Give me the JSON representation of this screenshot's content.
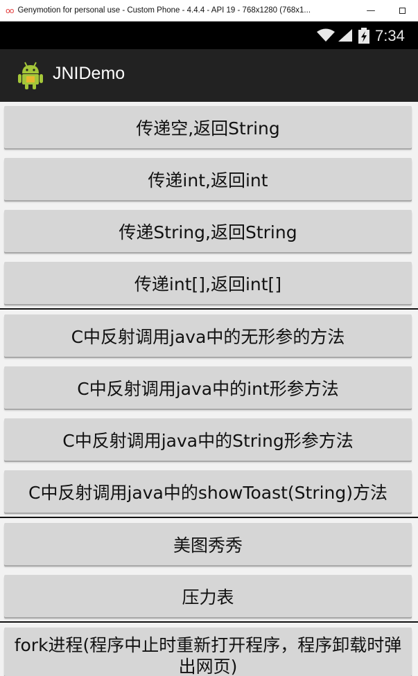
{
  "window": {
    "title": "Genymotion for personal use - Custom Phone - 4.4.4 - API 19 - 768x1280 (768x1...",
    "minimize_glyph": "—"
  },
  "status_bar": {
    "time": "7:34"
  },
  "action_bar": {
    "app_title": "JNIDemo"
  },
  "buttons": [
    {
      "label": "传递空,返回String"
    },
    {
      "label": "传递int,返回int"
    },
    {
      "label": "传递String,返回String"
    },
    {
      "label": "传递int[],返回int[]"
    },
    {
      "label": "C中反射调用java中的无形参的方法"
    },
    {
      "label": "C中反射调用java中的int形参方法"
    },
    {
      "label": "C中反射调用java中的String形参方法"
    },
    {
      "label": "C中反射调用java中的showToast(String)方法"
    },
    {
      "label": "美图秀秀"
    },
    {
      "label": "压力表"
    },
    {
      "label": "fork进程(程序中止时重新打开程序，程序卸载时弹出网页)"
    }
  ],
  "icons": {
    "window_logo": "genymotion-logo-icon",
    "wifi": "wifi-icon",
    "signal": "signal-icon",
    "battery": "battery-charging-icon",
    "app": "android-robot-icon"
  },
  "colors": {
    "action_bar": "#222222",
    "status_bar": "#000000",
    "button": "#d6d6d6",
    "background": "#f2f2f2"
  }
}
